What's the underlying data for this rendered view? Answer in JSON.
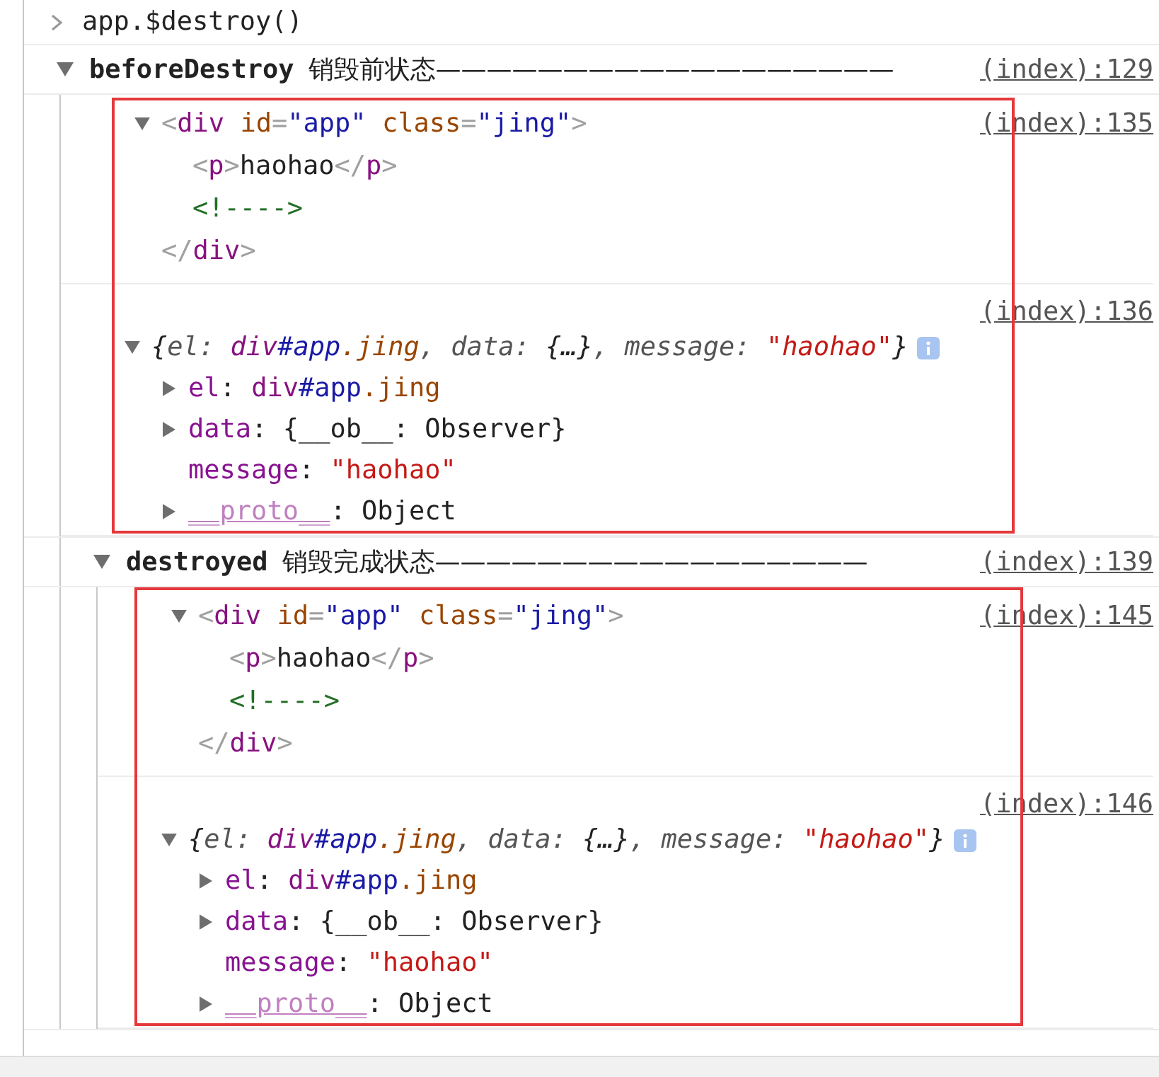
{
  "console": {
    "prompt": {
      "command": "app.$destroy()"
    },
    "groups": [
      {
        "label": "beforeDestroy",
        "note": "销毁前状态——————————————————",
        "source": "(index):129",
        "expanded": true,
        "highlighted": true,
        "messages": [
          {
            "kind": "element",
            "source": "(index):135",
            "root": {
              "expanded": true,
              "tokens": [
                {
                  "kind": "bracket",
                  "text": "<"
                },
                {
                  "kind": "tag",
                  "text": "div"
                },
                {
                  "kind": "attr",
                  "text": " id"
                },
                {
                  "kind": "bracket",
                  "text": "="
                },
                {
                  "kind": "value",
                  "text": "\"app\""
                },
                {
                  "kind": "attr",
                  "text": " class"
                },
                {
                  "kind": "bracket",
                  "text": "="
                },
                {
                  "kind": "value",
                  "text": "\"jing\""
                },
                {
                  "kind": "bracket",
                  "text": ">"
                }
              ],
              "children": [
                {
                  "tokens": [
                    {
                      "kind": "bracket",
                      "text": "<"
                    },
                    {
                      "kind": "tag",
                      "text": "p"
                    },
                    {
                      "kind": "bracket",
                      "text": ">"
                    },
                    {
                      "kind": "text",
                      "text": "haohao"
                    },
                    {
                      "kind": "bracket",
                      "text": "</"
                    },
                    {
                      "kind": "tag",
                      "text": "p"
                    },
                    {
                      "kind": "bracket",
                      "text": ">"
                    }
                  ]
                },
                {
                  "tokens": [
                    {
                      "kind": "comment",
                      "text": "<!---->"
                    }
                  ]
                }
              ],
              "closing": [
                {
                  "kind": "bracket",
                  "text": "</"
                },
                {
                  "kind": "tag",
                  "text": "div"
                },
                {
                  "kind": "bracket",
                  "text": ">"
                }
              ]
            }
          },
          {
            "kind": "object",
            "source": "(index):136",
            "root": {
              "expanded": true,
              "preview": true,
              "info": true,
              "tokens": [
                {
                  "kind": "text",
                  "text": "{"
                },
                {
                  "kind": "dim",
                  "text": "el: "
                },
                {
                  "kind": "tag",
                  "text": "div"
                },
                {
                  "kind": "value",
                  "text": "#app"
                },
                {
                  "kind": "attr",
                  "text": ".jing"
                },
                {
                  "kind": "dim",
                  "text": ", data: "
                },
                {
                  "kind": "text",
                  "text": "{…}"
                },
                {
                  "kind": "dim",
                  "text": ", message: "
                },
                {
                  "kind": "string",
                  "text": "\"haohao\""
                },
                {
                  "kind": "text",
                  "text": "}"
                }
              ],
              "children": [
                {
                  "expanded": false,
                  "tokens": [
                    {
                      "kind": "key",
                      "text": "el"
                    },
                    {
                      "kind": "text",
                      "text": ": "
                    },
                    {
                      "kind": "tag",
                      "text": "div"
                    },
                    {
                      "kind": "value",
                      "text": "#app"
                    },
                    {
                      "kind": "attr",
                      "text": ".jing"
                    }
                  ]
                },
                {
                  "expanded": false,
                  "tokens": [
                    {
                      "kind": "key",
                      "text": "data"
                    },
                    {
                      "kind": "text",
                      "text": ": {__ob__: Observer}"
                    }
                  ]
                },
                {
                  "tokens": [
                    {
                      "kind": "key",
                      "text": "message"
                    },
                    {
                      "kind": "text",
                      "text": ": "
                    },
                    {
                      "kind": "string",
                      "text": "\"haohao\""
                    }
                  ]
                },
                {
                  "expanded": false,
                  "tokens": [
                    {
                      "kind": "proto",
                      "text": "__proto__"
                    },
                    {
                      "kind": "text",
                      "text": ": Object"
                    }
                  ]
                }
              ]
            }
          }
        ],
        "children": [
          {
            "label": "destroyed",
            "note": "销毁完成状态—————————————————",
            "source": "(index):139",
            "expanded": true,
            "highlighted": true,
            "messages": [
              {
                "kind": "element",
                "source": "(index):145",
                "root": {
                  "expanded": true,
                  "tokens": [
                    {
                      "kind": "bracket",
                      "text": "<"
                    },
                    {
                      "kind": "tag",
                      "text": "div"
                    },
                    {
                      "kind": "attr",
                      "text": " id"
                    },
                    {
                      "kind": "bracket",
                      "text": "="
                    },
                    {
                      "kind": "value",
                      "text": "\"app\""
                    },
                    {
                      "kind": "attr",
                      "text": " class"
                    },
                    {
                      "kind": "bracket",
                      "text": "="
                    },
                    {
                      "kind": "value",
                      "text": "\"jing\""
                    },
                    {
                      "kind": "bracket",
                      "text": ">"
                    }
                  ],
                  "children": [
                    {
                      "tokens": [
                        {
                          "kind": "bracket",
                          "text": "<"
                        },
                        {
                          "kind": "tag",
                          "text": "p"
                        },
                        {
                          "kind": "bracket",
                          "text": ">"
                        },
                        {
                          "kind": "text",
                          "text": "haohao"
                        },
                        {
                          "kind": "bracket",
                          "text": "</"
                        },
                        {
                          "kind": "tag",
                          "text": "p"
                        },
                        {
                          "kind": "bracket",
                          "text": ">"
                        }
                      ]
                    },
                    {
                      "tokens": [
                        {
                          "kind": "comment",
                          "text": "<!---->"
                        }
                      ]
                    }
                  ],
                  "closing": [
                    {
                      "kind": "bracket",
                      "text": "</"
                    },
                    {
                      "kind": "tag",
                      "text": "div"
                    },
                    {
                      "kind": "bracket",
                      "text": ">"
                    }
                  ]
                }
              },
              {
                "kind": "object",
                "source": "(index):146",
                "root": {
                  "expanded": true,
                  "preview": true,
                  "info": true,
                  "tokens": [
                    {
                      "kind": "text",
                      "text": "{"
                    },
                    {
                      "kind": "dim",
                      "text": "el: "
                    },
                    {
                      "kind": "tag",
                      "text": "div"
                    },
                    {
                      "kind": "value",
                      "text": "#app"
                    },
                    {
                      "kind": "attr",
                      "text": ".jing"
                    },
                    {
                      "kind": "dim",
                      "text": ", data: "
                    },
                    {
                      "kind": "text",
                      "text": "{…}"
                    },
                    {
                      "kind": "dim",
                      "text": ", message: "
                    },
                    {
                      "kind": "string",
                      "text": "\"haohao\""
                    },
                    {
                      "kind": "text",
                      "text": "}"
                    }
                  ],
                  "children": [
                    {
                      "expanded": false,
                      "tokens": [
                        {
                          "kind": "key",
                          "text": "el"
                        },
                        {
                          "kind": "text",
                          "text": ": "
                        },
                        {
                          "kind": "tag",
                          "text": "div"
                        },
                        {
                          "kind": "value",
                          "text": "#app"
                        },
                        {
                          "kind": "attr",
                          "text": ".jing"
                        }
                      ]
                    },
                    {
                      "expanded": false,
                      "tokens": [
                        {
                          "kind": "key",
                          "text": "data"
                        },
                        {
                          "kind": "text",
                          "text": ": {__ob__: Observer}"
                        }
                      ]
                    },
                    {
                      "tokens": [
                        {
                          "kind": "key",
                          "text": "message"
                        },
                        {
                          "kind": "text",
                          "text": ": "
                        },
                        {
                          "kind": "string",
                          "text": "\"haohao\""
                        }
                      ]
                    },
                    {
                      "expanded": false,
                      "tokens": [
                        {
                          "kind": "proto",
                          "text": "__proto__"
                        },
                        {
                          "kind": "text",
                          "text": ": Object"
                        }
                      ]
                    }
                  ]
                }
              }
            ]
          }
        ]
      }
    ]
  }
}
